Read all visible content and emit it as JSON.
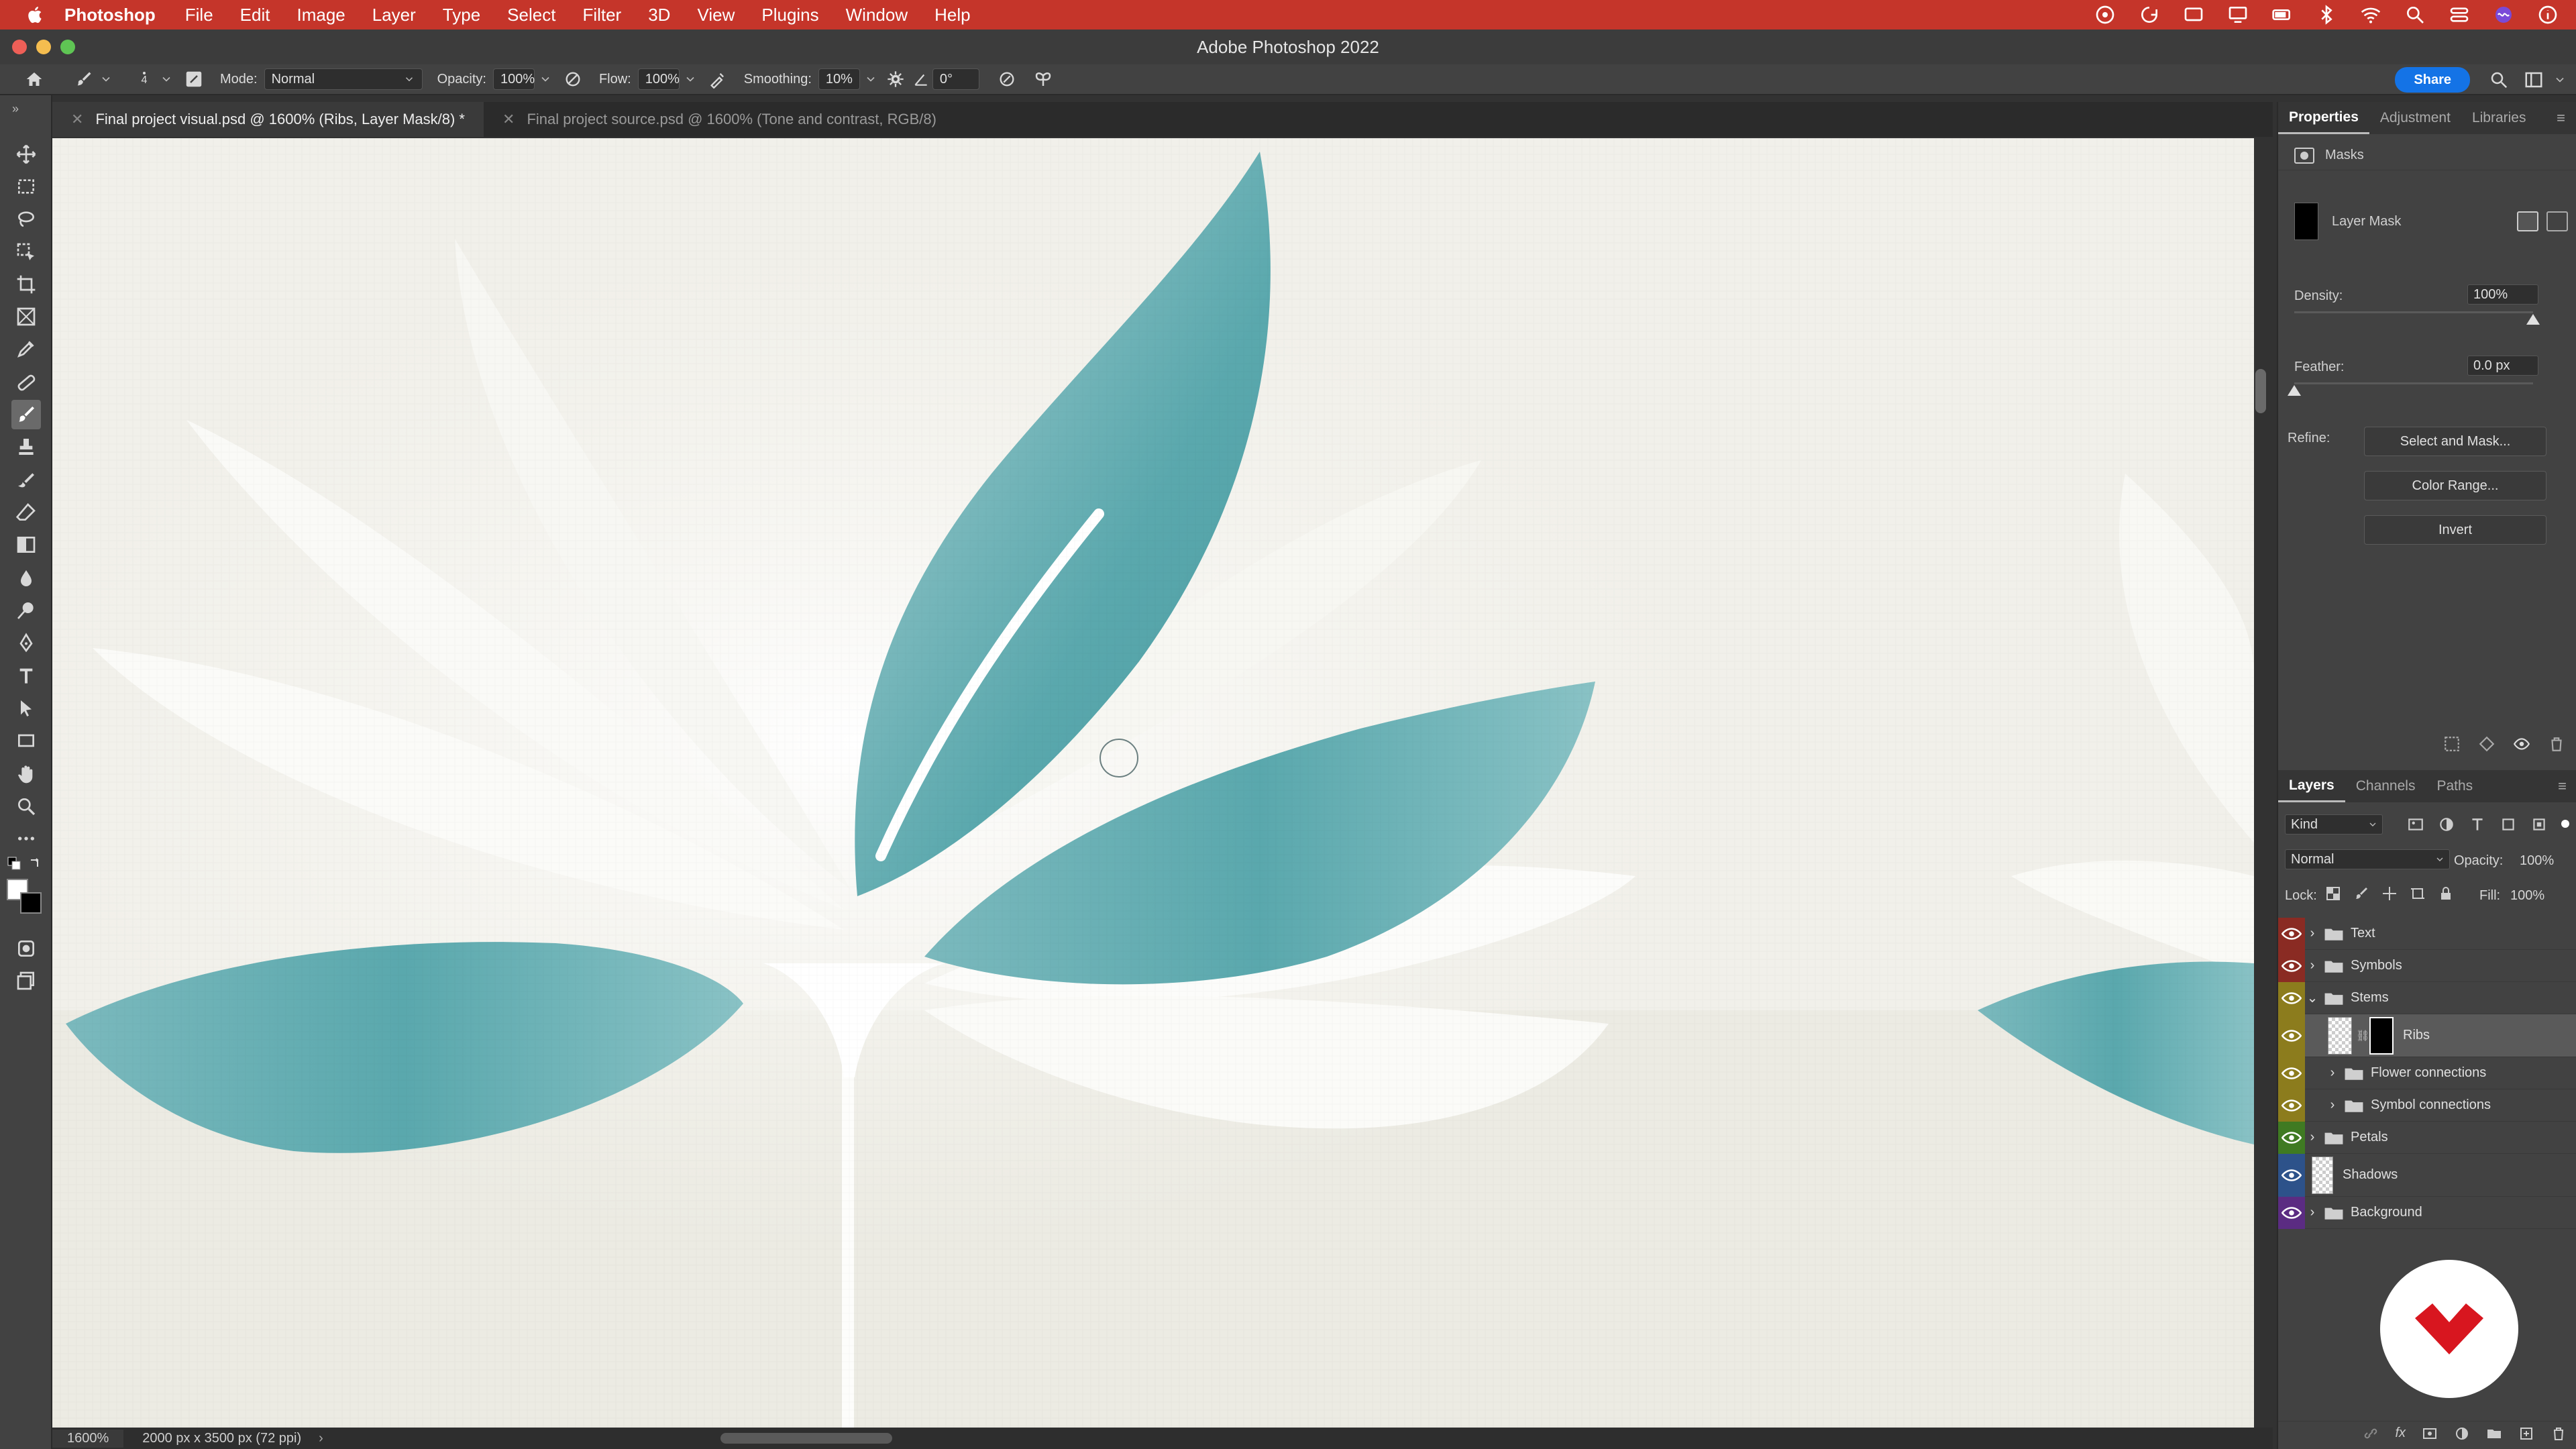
{
  "menubar": {
    "app_name": "Photoshop",
    "items": [
      "File",
      "Edit",
      "Image",
      "Layer",
      "Type",
      "Select",
      "Filter",
      "3D",
      "View",
      "Plugins",
      "Window",
      "Help"
    ]
  },
  "window": {
    "title": "Adobe Photoshop 2022"
  },
  "options": {
    "brush_size": "4",
    "mode_label": "Mode:",
    "mode_value": "Normal",
    "opacity_label": "Opacity:",
    "opacity_value": "100%",
    "flow_label": "Flow:",
    "flow_value": "100%",
    "smoothing_label": "Smoothing:",
    "smoothing_value": "10%",
    "angle_value": "0°",
    "share_label": "Share"
  },
  "tabs": [
    {
      "label": "Final project visual.psd @ 1600% (Ribs, Layer Mask/8) *",
      "active": true
    },
    {
      "label": "Final project source.psd @ 1600% (Tone and contrast, RGB/8)",
      "active": false
    }
  ],
  "status": {
    "zoom": "1600%",
    "doc_size": "2000 px x 3500 px (72 ppi)"
  },
  "properties": {
    "tabs": [
      "Properties",
      "Adjustment",
      "Libraries"
    ],
    "section": "Masks",
    "mask_name": "Layer Mask",
    "density_label": "Density:",
    "density_value": "100%",
    "density_level": 1.0,
    "feather_label": "Feather:",
    "feather_value": "0.0 px",
    "feather_level": 0.0,
    "refine_label": "Refine:",
    "buttons": [
      "Select and Mask...",
      "Color Range...",
      "Invert"
    ]
  },
  "layers_panel": {
    "tabs": [
      "Layers",
      "Channels",
      "Paths"
    ],
    "filter_label": "Kind",
    "blend_mode": "Normal",
    "opacity_label": "Opacity:",
    "opacity_value": "100%",
    "lock_label": "Lock:",
    "fill_label": "Fill:",
    "fill_value": "100%",
    "layers": [
      {
        "name": "Text",
        "type": "group",
        "color": "#c0392b",
        "depth": 0,
        "expanded": false
      },
      {
        "name": "Symbols",
        "type": "group",
        "color": "#c0392b",
        "depth": 0,
        "expanded": false
      },
      {
        "name": "Stems",
        "type": "group",
        "color": "#b8a227",
        "depth": 0,
        "expanded": true
      },
      {
        "name": "Ribs",
        "type": "layer",
        "color": "#b8a227",
        "depth": 1,
        "selected": true
      },
      {
        "name": "Flower connections",
        "type": "group",
        "color": "#b8a227",
        "depth": 1,
        "expanded": false
      },
      {
        "name": "Symbol connections",
        "type": "group",
        "color": "#b8a227",
        "depth": 1,
        "expanded": false
      },
      {
        "name": "Petals",
        "type": "group",
        "color": "#5aa032",
        "depth": 0,
        "expanded": false
      },
      {
        "name": "Shadows",
        "type": "layer",
        "color": "#3b6fb5",
        "depth": 0
      },
      {
        "name": "Background",
        "type": "group",
        "color": "#7d3fb0",
        "depth": 0,
        "expanded": false
      }
    ]
  },
  "colors": {
    "menubar": "#c5352a",
    "accent": "#1473e6",
    "petal_teal": "#5aa8ad",
    "canvas_bg": "#ecebe3"
  }
}
